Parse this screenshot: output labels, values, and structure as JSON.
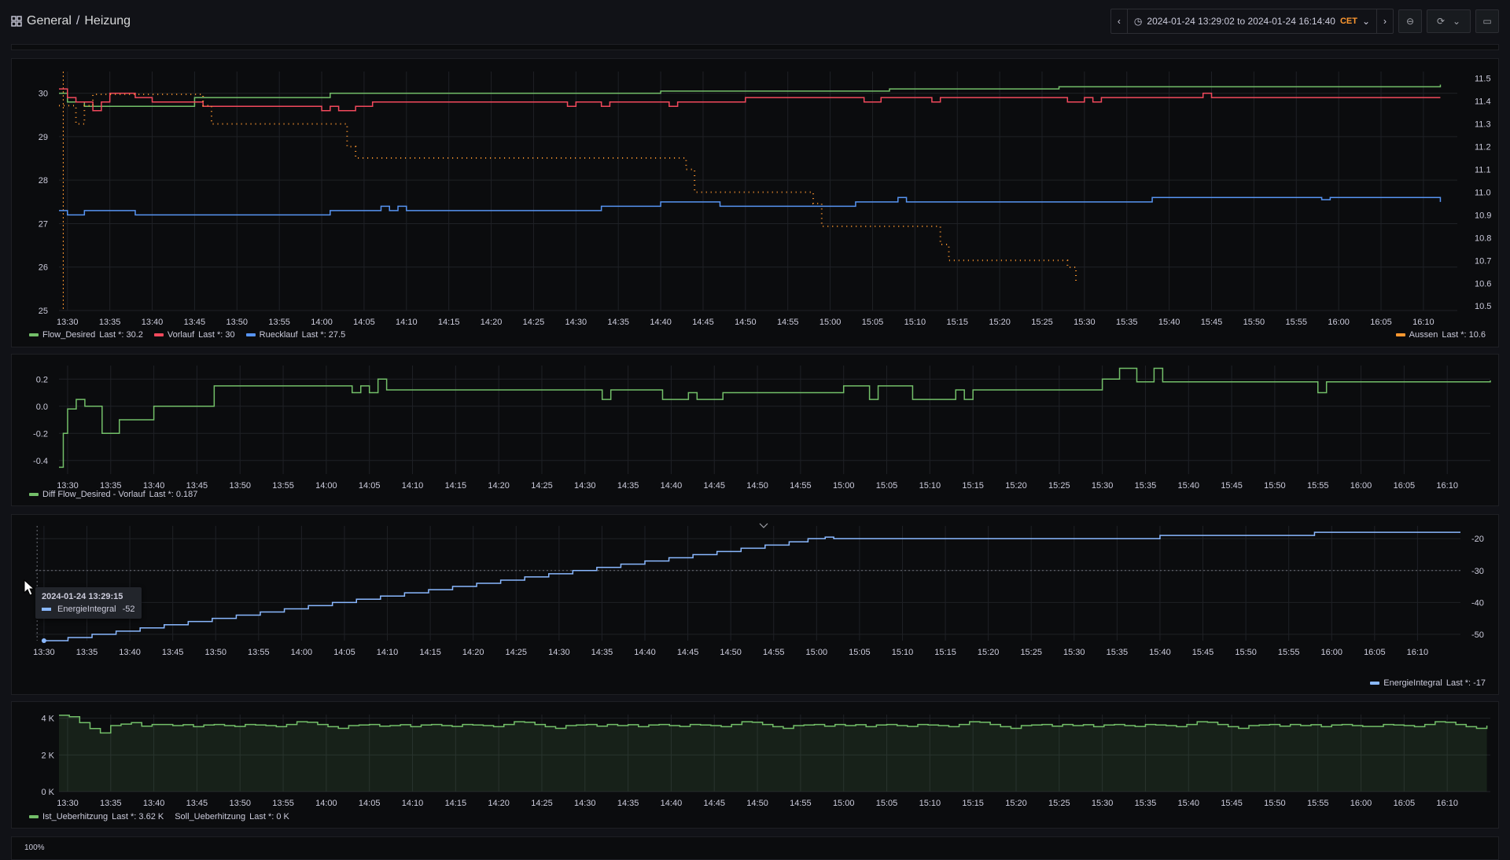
{
  "breadcrumb": {
    "folder": "General",
    "separator": "/",
    "dashboard": "Heizung"
  },
  "time_range": {
    "text": "2024-01-24 13:29:02 to 2024-01-24 16:14:40",
    "timezone": "CET"
  },
  "colors": {
    "green": "#73bf69",
    "red": "#f2495c",
    "blue": "#5794f2",
    "orange": "#ff9830",
    "lightblue": "#8ab8ff"
  },
  "x_ticks": [
    "13:30",
    "13:35",
    "13:40",
    "13:45",
    "13:50",
    "13:55",
    "14:00",
    "14:05",
    "14:10",
    "14:15",
    "14:20",
    "14:25",
    "14:30",
    "14:35",
    "14:40",
    "14:45",
    "14:50",
    "14:55",
    "15:00",
    "15:05",
    "15:10",
    "15:15",
    "15:20",
    "15:25",
    "15:30",
    "15:35",
    "15:40",
    "15:45",
    "15:50",
    "15:55",
    "16:00",
    "16:05",
    "16:10"
  ],
  "panels": [
    {
      "legend_left": [
        {
          "name": "Flow_Desired",
          "last": "Last *: 30.2",
          "color": "#73bf69"
        },
        {
          "name": "Vorlauf",
          "last": "Last *: 30",
          "color": "#f2495c"
        },
        {
          "name": "Ruecklauf",
          "last": "Last *: 27.5",
          "color": "#5794f2"
        }
      ],
      "legend_right": [
        {
          "name": "Aussen",
          "last": "Last *: 10.6",
          "color": "#ff9830"
        }
      ]
    },
    {
      "legend_left": [
        {
          "name": "Diff Flow_Desired - Vorlauf",
          "last": "Last *: 0.187",
          "color": "#73bf69"
        }
      ]
    },
    {
      "legend_right": [
        {
          "name": "EnergieIntegral",
          "last": "Last *: -17",
          "color": "#8ab8ff"
        }
      ],
      "tooltip": {
        "time": "2024-01-24 13:29:15",
        "series": "EnergieIntegral",
        "value": "-52"
      }
    },
    {
      "legend_left": [
        {
          "name": "Ist_Ueberhitzung",
          "last": "Last *: 3.62 K",
          "color": "#73bf69"
        },
        {
          "name": "Soll_Ueberhitzung",
          "last": "Last *: 0 K",
          "color": ""
        }
      ]
    },
    {
      "y_top_label": "100%"
    }
  ],
  "chart_data": [
    {
      "type": "line",
      "x_unit": "minutes since 13:30",
      "xlim": [
        -1,
        164
      ],
      "y_left": {
        "ticks": [
          25,
          26,
          27,
          28,
          29,
          30
        ],
        "lim": [
          25,
          30.5
        ]
      },
      "y_right": {
        "ticks": [
          10.5,
          10.6,
          10.7,
          10.8,
          10.9,
          11.0,
          11.1,
          11.2,
          11.3,
          11.4,
          11.5
        ],
        "lim": [
          10.48,
          11.53
        ]
      },
      "series": [
        {
          "name": "Flow_Desired",
          "axis": "left",
          "step": true,
          "points": [
            [
              -1,
              30.0
            ],
            [
              0,
              29.8
            ],
            [
              2,
              29.7
            ],
            [
              5,
              29.7
            ],
            [
              9,
              29.7
            ],
            [
              15,
              29.9
            ],
            [
              19,
              29.9
            ],
            [
              25,
              29.9
            ],
            [
              31,
              30.0
            ],
            [
              50,
              30.0
            ],
            [
              55,
              30.0
            ],
            [
              60,
              30.0
            ],
            [
              70,
              30.05
            ],
            [
              85,
              30.05
            ],
            [
              97,
              30.1
            ],
            [
              108,
              30.1
            ],
            [
              110,
              30.1
            ],
            [
              117,
              30.15
            ],
            [
              140,
              30.15
            ],
            [
              142,
              30.15
            ],
            [
              162,
              30.2
            ]
          ]
        },
        {
          "name": "Vorlauf",
          "axis": "left",
          "step": true,
          "points": [
            [
              -1,
              30.1
            ],
            [
              0,
              29.9
            ],
            [
              1,
              29.8
            ],
            [
              3,
              29.6
            ],
            [
              4,
              29.8
            ],
            [
              5,
              30.0
            ],
            [
              6,
              30.0
            ],
            [
              8,
              29.9
            ],
            [
              10,
              29.8
            ],
            [
              14,
              29.8
            ],
            [
              16,
              29.7
            ],
            [
              24,
              29.7
            ],
            [
              30,
              29.6
            ],
            [
              31,
              29.7
            ],
            [
              32,
              29.6
            ],
            [
              34,
              29.7
            ],
            [
              36,
              29.8
            ],
            [
              58,
              29.8
            ],
            [
              59,
              29.7
            ],
            [
              60,
              29.8
            ],
            [
              63,
              29.7
            ],
            [
              64,
              29.8
            ],
            [
              70,
              29.8
            ],
            [
              71,
              29.7
            ],
            [
              72,
              29.8
            ],
            [
              80,
              29.9
            ],
            [
              93,
              29.9
            ],
            [
              94,
              29.8
            ],
            [
              96,
              29.9
            ],
            [
              101,
              29.9
            ],
            [
              102,
              29.8
            ],
            [
              103,
              29.9
            ],
            [
              117,
              29.9
            ],
            [
              118,
              29.8
            ],
            [
              120,
              29.9
            ],
            [
              121,
              29.8
            ],
            [
              122,
              29.9
            ],
            [
              133,
              29.9
            ],
            [
              134,
              30.0
            ],
            [
              135,
              29.9
            ],
            [
              162,
              29.9
            ]
          ]
        },
        {
          "name": "Ruecklauf",
          "axis": "left",
          "step": true,
          "points": [
            [
              -1,
              27.3
            ],
            [
              0,
              27.2
            ],
            [
              2,
              27.3
            ],
            [
              8,
              27.2
            ],
            [
              31,
              27.3
            ],
            [
              37,
              27.4
            ],
            [
              38,
              27.3
            ],
            [
              39,
              27.4
            ],
            [
              40,
              27.3
            ],
            [
              63,
              27.4
            ],
            [
              70,
              27.5
            ],
            [
              77,
              27.4
            ],
            [
              93,
              27.5
            ],
            [
              98,
              27.6
            ],
            [
              99,
              27.5
            ],
            [
              128,
              27.6
            ],
            [
              148,
              27.55
            ],
            [
              149,
              27.6
            ],
            [
              162,
              27.5
            ]
          ]
        },
        {
          "name": "Aussen",
          "axis": "right",
          "step": true,
          "dotted": true,
          "points": [
            [
              -1,
              11.38
            ],
            [
              1,
              11.3
            ],
            [
              2,
              11.38
            ],
            [
              3,
              11.43
            ],
            [
              16,
              11.38
            ],
            [
              17,
              11.3
            ],
            [
              33,
              11.2
            ],
            [
              34,
              11.15
            ],
            [
              73,
              11.1
            ],
            [
              74,
              11.0
            ],
            [
              88,
              10.95
            ],
            [
              89,
              10.85
            ],
            [
              103,
              10.77
            ],
            [
              104,
              10.7
            ],
            [
              118,
              10.67
            ],
            [
              119,
              10.6
            ]
          ]
        }
      ]
    },
    {
      "type": "line",
      "x_unit": "minutes since 13:30",
      "xlim": [
        -1,
        165
      ],
      "y": {
        "ticks": [
          0.2,
          0.0,
          -0.2,
          -0.4
        ],
        "lim": [
          -0.5,
          0.3
        ]
      },
      "series": [
        {
          "name": "Diff Flow_Desired - Vorlauf",
          "step": true,
          "points": [
            [
              -1,
              -0.45
            ],
            [
              -0.5,
              -0.2
            ],
            [
              0,
              -0.02
            ],
            [
              1,
              0.05
            ],
            [
              2,
              0.0
            ],
            [
              4,
              -0.2
            ],
            [
              6,
              -0.1
            ],
            [
              10,
              0.0
            ],
            [
              17,
              0.15
            ],
            [
              33,
              0.1
            ],
            [
              34,
              0.15
            ],
            [
              35,
              0.1
            ],
            [
              36,
              0.2
            ],
            [
              37,
              0.12
            ],
            [
              40,
              0.12
            ],
            [
              62,
              0.05
            ],
            [
              63,
              0.12
            ],
            [
              69,
              0.05
            ],
            [
              72,
              0.1
            ],
            [
              73,
              0.05
            ],
            [
              76,
              0.1
            ],
            [
              90,
              0.15
            ],
            [
              93,
              0.05
            ],
            [
              94,
              0.15
            ],
            [
              98,
              0.05
            ],
            [
              103,
              0.12
            ],
            [
              104,
              0.05
            ],
            [
              105,
              0.12
            ],
            [
              120,
              0.2
            ],
            [
              122,
              0.28
            ],
            [
              124,
              0.18
            ],
            [
              126,
              0.28
            ],
            [
              127,
              0.18
            ],
            [
              145,
              0.1
            ],
            [
              146,
              0.18
            ],
            [
              165,
              0.19
            ]
          ]
        }
      ]
    },
    {
      "type": "line",
      "x_unit": "minutes since 13:30",
      "xlim": [
        -1,
        165
      ],
      "y": {
        "ticks": [
          -20,
          -30,
          -40,
          -50
        ],
        "lim": [
          -52,
          -16
        ]
      },
      "series": [
        {
          "name": "EnergieIntegral",
          "step": true,
          "points": [
            [
              0,
              -52
            ],
            [
              2.8,
              -51
            ],
            [
              5.6,
              -50
            ],
            [
              8.4,
              -49
            ],
            [
              11.2,
              -48
            ],
            [
              14,
              -47
            ],
            [
              16.8,
              -46
            ],
            [
              19.6,
              -45
            ],
            [
              22.4,
              -44
            ],
            [
              25.2,
              -43
            ],
            [
              28,
              -42
            ],
            [
              30.8,
              -41
            ],
            [
              33.6,
              -40
            ],
            [
              36.4,
              -39
            ],
            [
              39.2,
              -38
            ],
            [
              42,
              -37
            ],
            [
              44.8,
              -36
            ],
            [
              47.6,
              -35
            ],
            [
              50.4,
              -34
            ],
            [
              53.2,
              -33
            ],
            [
              56,
              -32
            ],
            [
              58.8,
              -31
            ],
            [
              61.6,
              -30
            ],
            [
              64.4,
              -29
            ],
            [
              67.2,
              -28
            ],
            [
              70,
              -27
            ],
            [
              72.8,
              -26
            ],
            [
              75.6,
              -25
            ],
            [
              78.4,
              -24
            ],
            [
              81.2,
              -23
            ],
            [
              84,
              -22
            ],
            [
              86.8,
              -21
            ],
            [
              89,
              -20
            ],
            [
              91,
              -19.5
            ],
            [
              92,
              -20
            ],
            [
              130,
              -19
            ],
            [
              148,
              -18
            ],
            [
              165,
              -18
            ]
          ]
        }
      ]
    },
    {
      "type": "area",
      "x_unit": "minutes since 13:30",
      "xlim": [
        -1,
        165
      ],
      "y": {
        "ticks": [
          "4 K",
          "2 K",
          "0 K"
        ],
        "lim": [
          0,
          4.2
        ]
      },
      "series": [
        {
          "name": "Ist_Ueberhitzung",
          "approx_value": 3.6
        },
        {
          "name": "Soll_Ueberhitzung",
          "approx_value": 0
        }
      ]
    }
  ]
}
